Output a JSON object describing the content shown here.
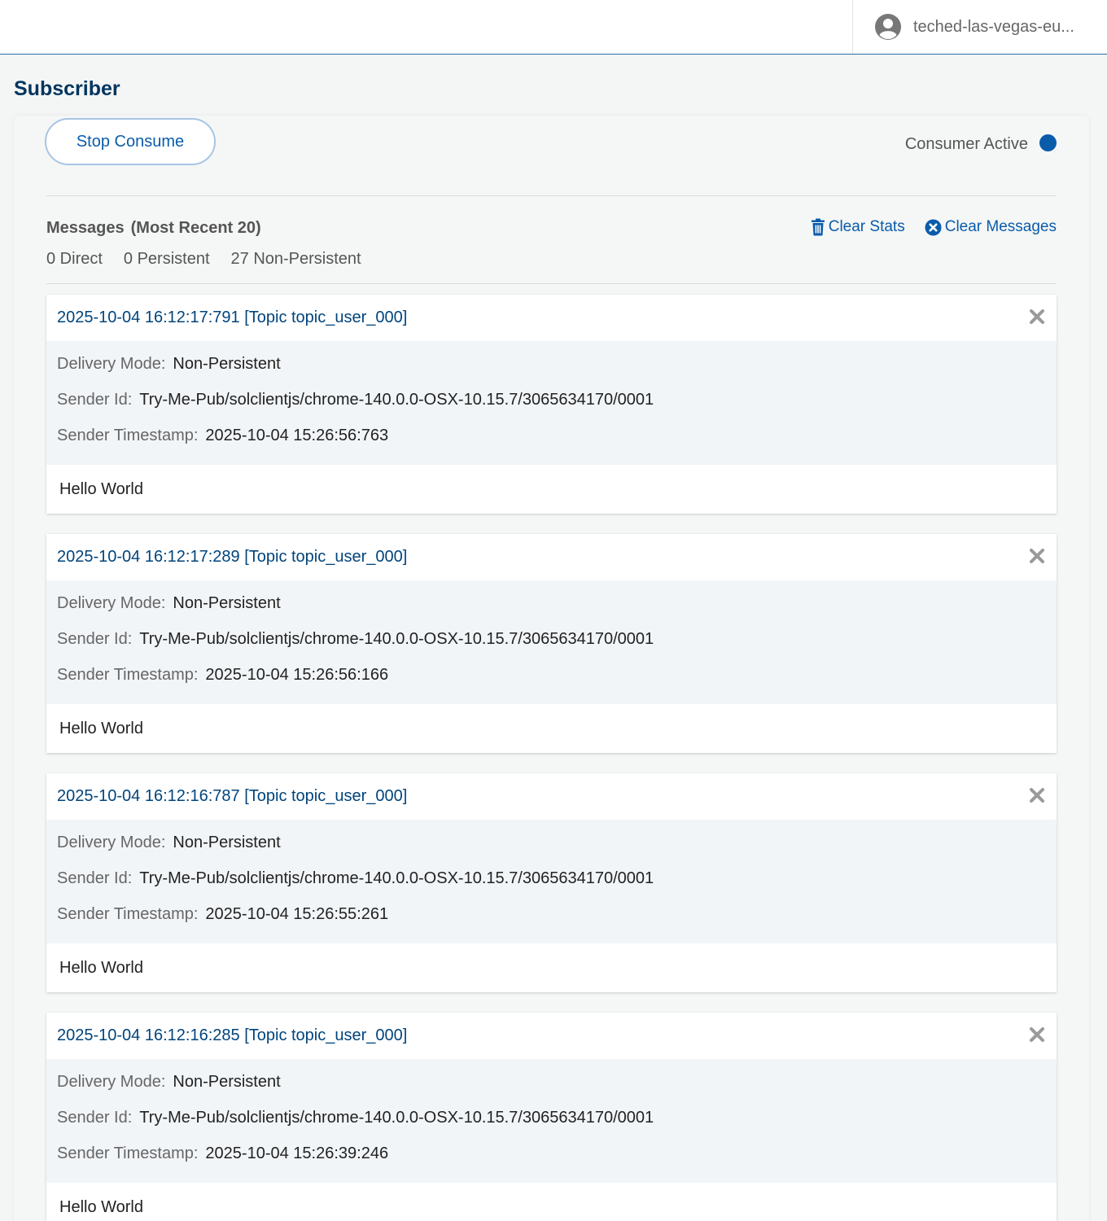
{
  "header": {
    "account_name": "teched-las-vegas-eu...",
    "account_icon": "account-circle-icon"
  },
  "page": {
    "title": "Subscriber"
  },
  "consumer": {
    "stop_label": "Stop Consume",
    "status_label": "Consumer Active",
    "status_color": "#0a5cab"
  },
  "messages": {
    "heading": "Messages",
    "subheading": "(Most Recent 20)",
    "clear_stats_label": "Clear Stats",
    "clear_messages_label": "Clear Messages",
    "counts": {
      "direct": "0 Direct",
      "persistent": "0 Persistent",
      "non_persistent": "27 Non-Persistent"
    },
    "field_labels": {
      "delivery_mode": "Delivery Mode:",
      "sender_id": "Sender Id:",
      "sender_timestamp": "Sender Timestamp:"
    },
    "items": [
      {
        "title": "2025-10-04 16:12:17:791 [Topic topic_user_000]",
        "delivery_mode": "Non-Persistent",
        "sender_id": "Try-Me-Pub/solclientjs/chrome-140.0.0-OSX-10.15.7/3065634170/0001",
        "sender_timestamp": "2025-10-04 15:26:56:763",
        "body": "Hello World"
      },
      {
        "title": "2025-10-04 16:12:17:289 [Topic topic_user_000]",
        "delivery_mode": "Non-Persistent",
        "sender_id": "Try-Me-Pub/solclientjs/chrome-140.0.0-OSX-10.15.7/3065634170/0001",
        "sender_timestamp": "2025-10-04 15:26:56:166",
        "body": "Hello World"
      },
      {
        "title": "2025-10-04 16:12:16:787 [Topic topic_user_000]",
        "delivery_mode": "Non-Persistent",
        "sender_id": "Try-Me-Pub/solclientjs/chrome-140.0.0-OSX-10.15.7/3065634170/0001",
        "sender_timestamp": "2025-10-04 15:26:55:261",
        "body": "Hello World"
      },
      {
        "title": "2025-10-04 16:12:16:285 [Topic topic_user_000]",
        "delivery_mode": "Non-Persistent",
        "sender_id": "Try-Me-Pub/solclientjs/chrome-140.0.0-OSX-10.15.7/3065634170/0001",
        "sender_timestamp": "2025-10-04 15:26:39:246",
        "body": "Hello World"
      }
    ]
  }
}
